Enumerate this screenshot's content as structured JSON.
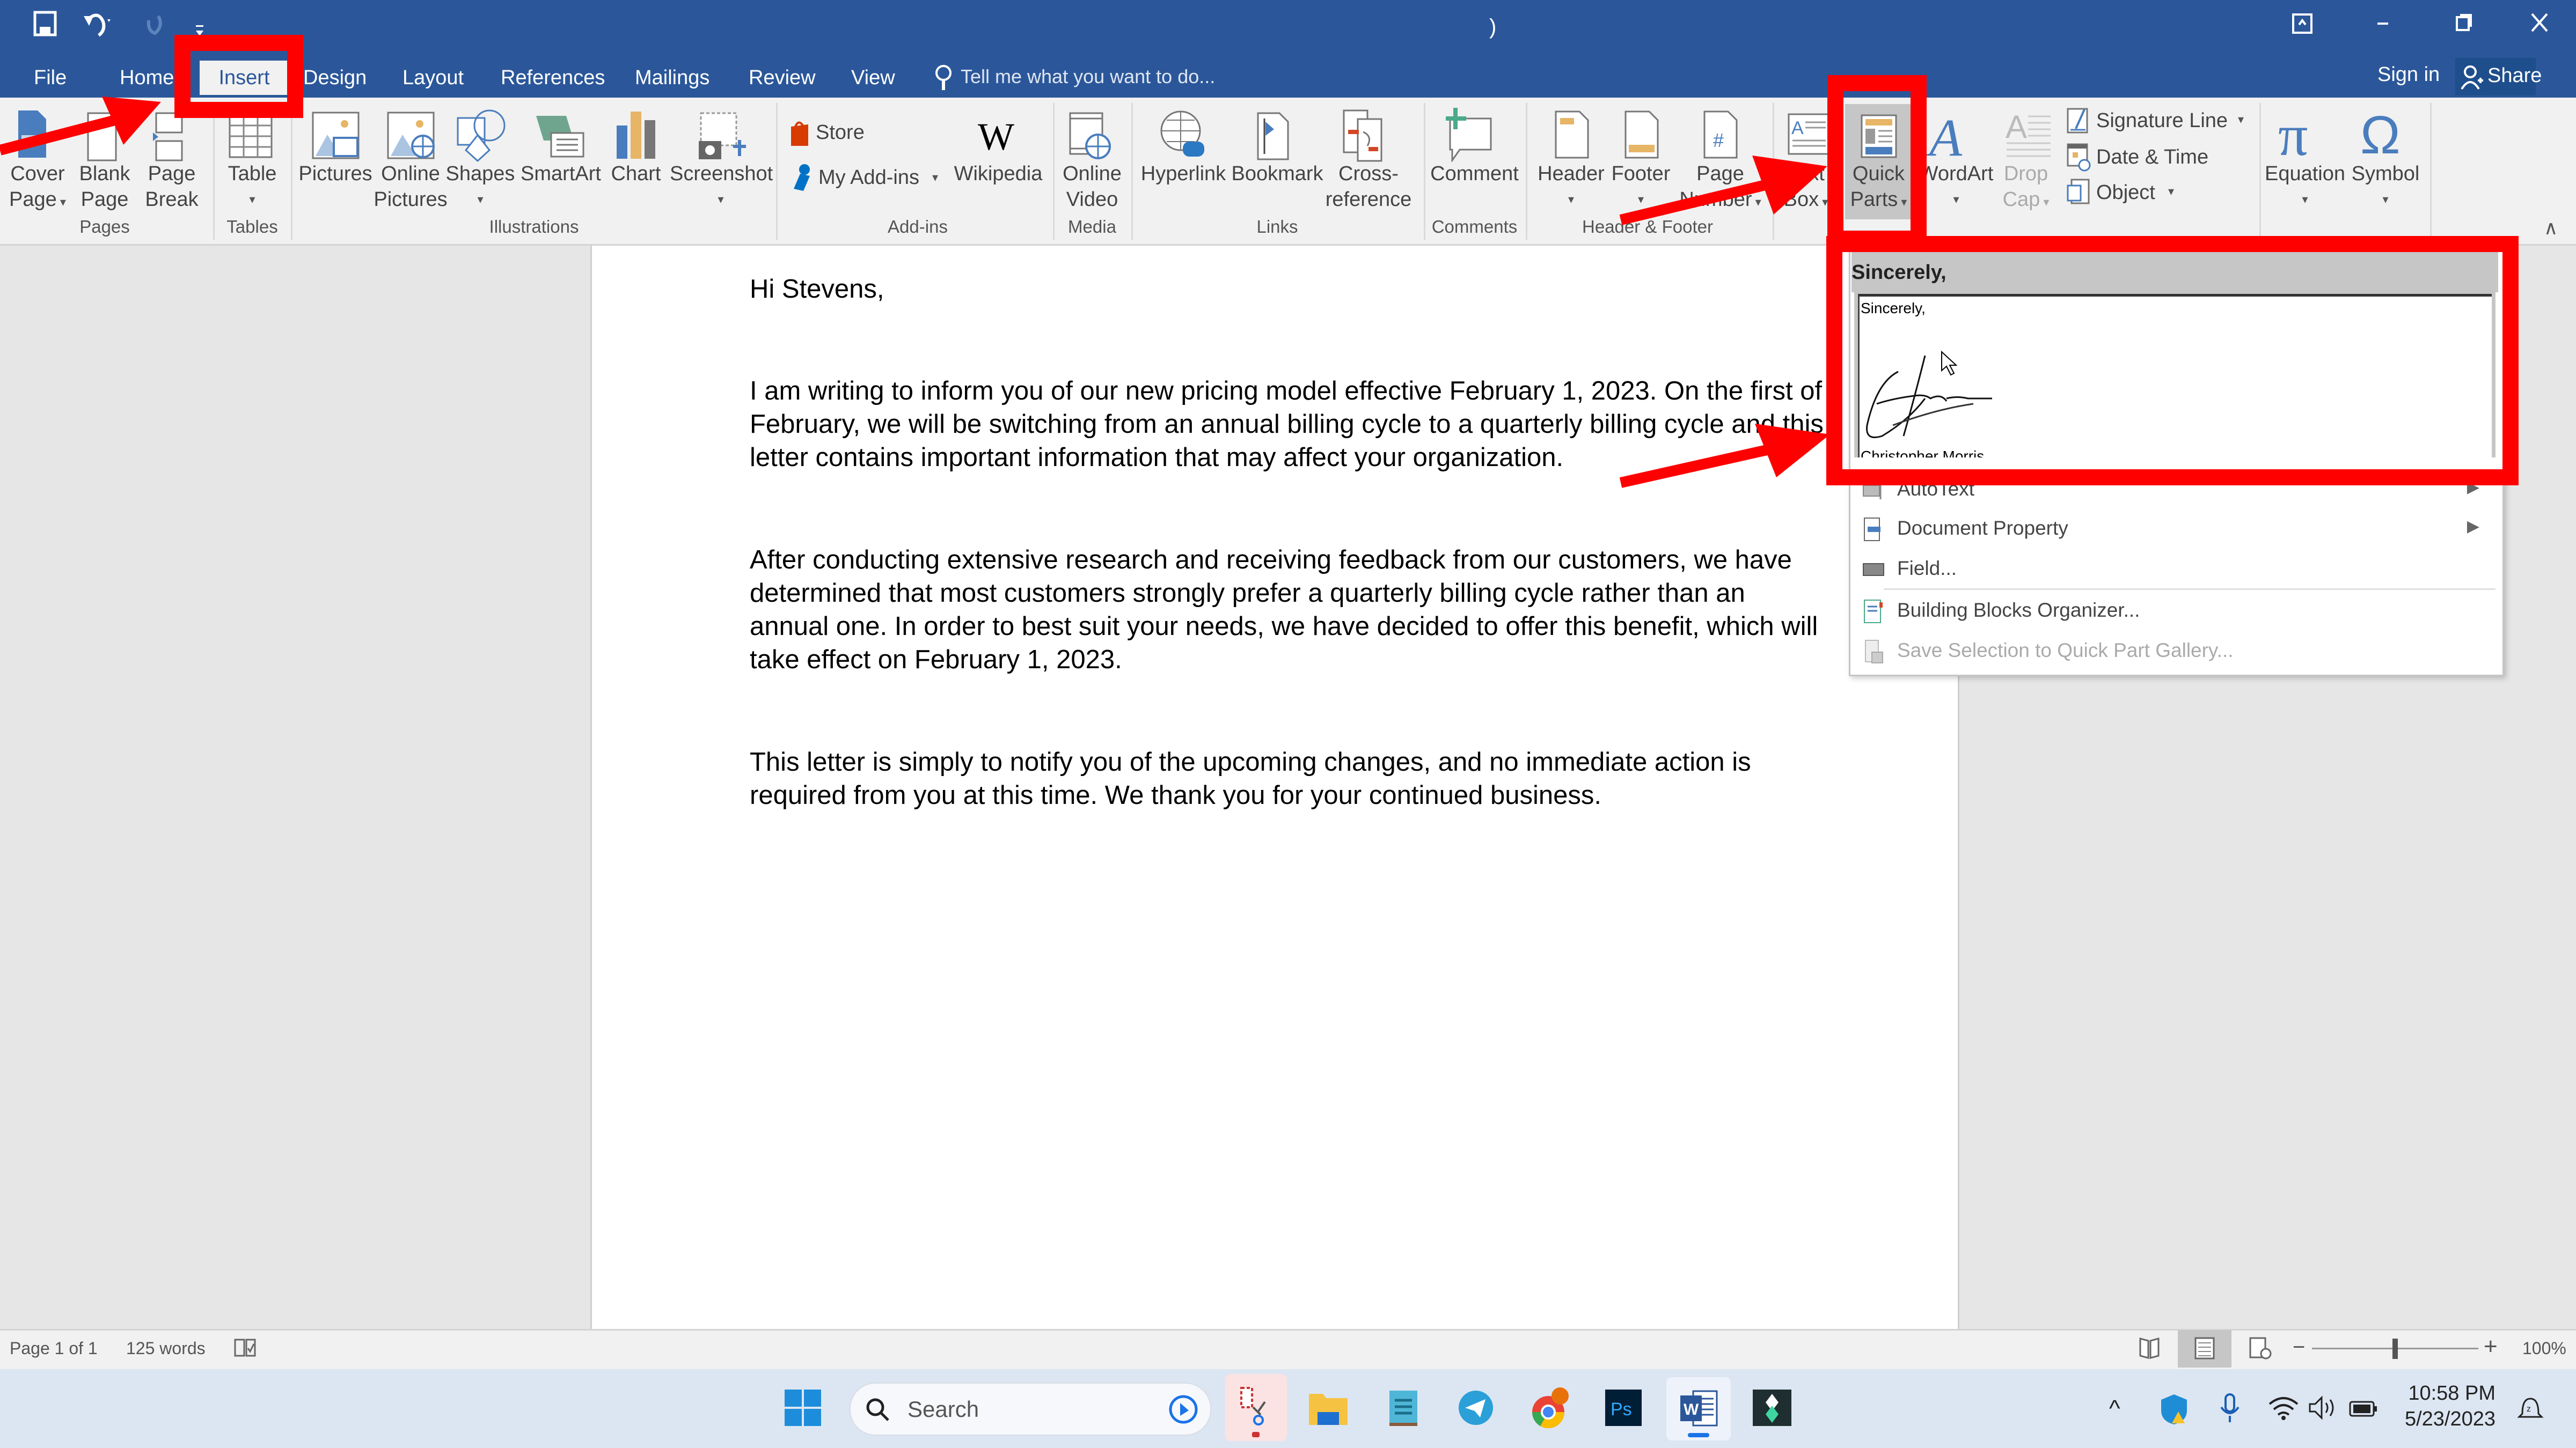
{
  "titlebar": {
    "title": ")",
    "qat": {
      "save": "save-icon",
      "undo": "undo-icon",
      "redo": "redo-icon",
      "customize": "customize-qat-icon"
    },
    "window_controls": [
      "ribbon-display-options",
      "minimize",
      "restore",
      "close"
    ]
  },
  "tabs": [
    {
      "label": "File"
    },
    {
      "label": "Home"
    },
    {
      "label": "Insert",
      "active": true
    },
    {
      "label": "Design"
    },
    {
      "label": "Layout"
    },
    {
      "label": "References"
    },
    {
      "label": "Mailings"
    },
    {
      "label": "Review"
    },
    {
      "label": "View"
    }
  ],
  "tell_me": "Tell me what you want to do...",
  "sign_in": "Sign in",
  "share": "Share",
  "ribbon": {
    "groups": {
      "pages": "Pages",
      "tables": "Tables",
      "illustrations": "Illustrations",
      "addins": "Add-ins",
      "media": "Media",
      "links": "Links",
      "comments": "Comments",
      "header_footer": "Header & Footer"
    },
    "buttons": {
      "cover_page": [
        "Cover",
        "Page"
      ],
      "blank_page": [
        "Blank",
        "Page"
      ],
      "page_break": [
        "Page",
        "Break"
      ],
      "table": "Table",
      "pictures": "Pictures",
      "online_pictures": [
        "Online",
        "Pictures"
      ],
      "shapes": "Shapes",
      "smartart": "SmartArt",
      "chart": "Chart",
      "screenshot": "Screenshot",
      "store": "Store",
      "my_addins": "My Add-ins",
      "wikipedia": "Wikipedia",
      "online_video": [
        "Online",
        "Video"
      ],
      "hyperlink": "Hyperlink",
      "bookmark": "Bookmark",
      "cross_reference": [
        "Cross-",
        "reference"
      ],
      "comment": "Comment",
      "header": "Header",
      "footer": "Footer",
      "page_number": [
        "Page",
        "Number"
      ],
      "text_box": [
        "Text",
        "Box"
      ],
      "quick_parts": [
        "Quick",
        "Parts"
      ],
      "wordart": "WordArt",
      "drop_cap": [
        "Drop",
        "Cap"
      ],
      "signature_line": "Signature Line",
      "date_time": "Date & Time",
      "object": "Object",
      "equation": "Equation",
      "symbol": "Symbol"
    }
  },
  "quick_parts_menu": {
    "gallery_header": "Sincerely,",
    "gallery_preview_text": "Sincerely,",
    "gallery_preview_name_partial": "Christopher Morris",
    "items": [
      {
        "label": "AutoText",
        "icon": "autotext-icon",
        "submenu": true,
        "disabled": false
      },
      {
        "label": "Document Property",
        "icon": "document-property-icon",
        "submenu": true,
        "disabled": false
      },
      {
        "label": "Field...",
        "icon": "field-icon",
        "submenu": false,
        "disabled": false
      },
      {
        "label": "Building Blocks Organizer...",
        "icon": "building-blocks-icon",
        "submenu": false,
        "disabled": false
      },
      {
        "label": "Save Selection to Quick Part Gallery...",
        "icon": "save-selection-icon",
        "submenu": false,
        "disabled": true
      }
    ]
  },
  "document": {
    "greeting": "Hi Stevens,",
    "paragraphs": [
      "I am writing to inform you of our new pricing model effective February 1, 2023. On the first of February, we will be switching from an annual billing cycle to a quarterly billing cycle and this letter contains important information that may affect your organization.",
      "After conducting extensive research and receiving feedback from our customers, we have determined that most customers strongly prefer a quarterly billing cycle rather than an annual one. In order to best suit your needs, we have decided to offer this benefit, which will take effect on February 1, 2023.",
      "This letter is simply to notify you of the upcoming changes, and no immediate action is required from you at this time. We thank you for your continued business."
    ]
  },
  "statusbar": {
    "page": "Page 1 of 1",
    "words": "125 words",
    "zoom": "100%",
    "zoom_level_percent": 100
  },
  "taskbar": {
    "search_placeholder": "Search",
    "apps": [
      "snipping-tool",
      "file-explorer",
      "notepad",
      "telegram",
      "chrome",
      "photoshop",
      "word",
      "filmora"
    ],
    "time": "10:58 PM",
    "date": "5/23/2023"
  },
  "annotation_color": "#ff0000",
  "brand_color": "#2b579a"
}
